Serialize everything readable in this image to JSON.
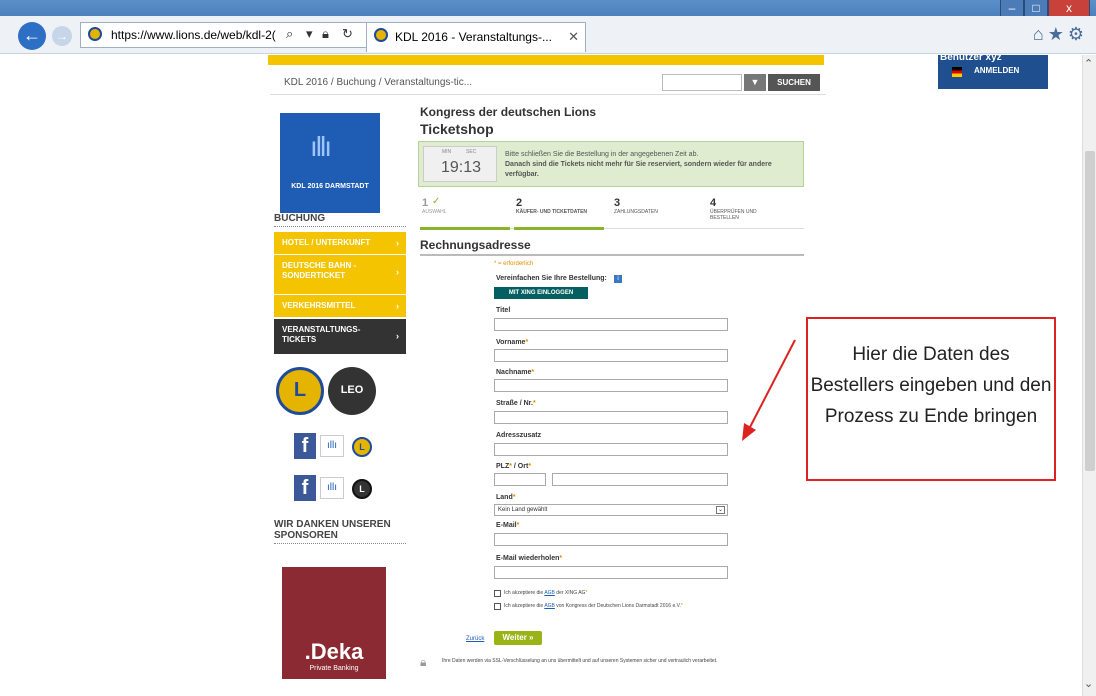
{
  "browser": {
    "url": "https://www.lions.de/web/kdl-2(",
    "tab_title": "KDL 2016 - Veranstaltungs-...",
    "window_controls": [
      "–",
      "□",
      "x"
    ]
  },
  "page": {
    "breadcrumb": "KDL 2016 / Buchung / Veranstaltungs-tic...",
    "search_button": "SUCHEN",
    "user_name": "Benutzer xyz",
    "login": "ANMELDEN",
    "logo_text": "KDL 2016 DARMSTADT",
    "sidebar_heading": "BUCHUNG",
    "sidebar_items": [
      {
        "label": "HOTEL / UNTERKUNFT"
      },
      {
        "label": "DEUTSCHE BAHN - SONDERTICKET"
      },
      {
        "label": "VERKEHRSMITTEL"
      },
      {
        "label": "VERANSTALTUNGS-TICKETS"
      }
    ],
    "sponsors_heading": "WIR DANKEN UNSEREN SPONSOREN",
    "sponsor": {
      "name": ".Deka",
      "tagline": "Private Banking"
    },
    "shop_title": "Kongress der deutschen Lions",
    "shop_subtitle": "Ticketshop",
    "timer": {
      "label_left": "MIN",
      "label_right": "SEC",
      "time": "19:13",
      "message_line1": "Bitte schließen Sie die Bestellung in der angegebenen Zeit ab.",
      "message_line2": "Danach sind die Tickets nicht mehr für Sie reserviert, sondern wieder für andere verfügbar."
    },
    "steps": [
      {
        "num": "1",
        "label": "AUSWAHL"
      },
      {
        "num": "2",
        "label": "KÄUFER- UND TICKETDATEN"
      },
      {
        "num": "3",
        "label": "ZAHLUNGSDATEN"
      },
      {
        "num": "4",
        "label": "ÜBERPRÜFEN UND BESTELLEN"
      }
    ],
    "section_title": "Rechnungsadresse",
    "required_note": "* = erforderlich",
    "xing_note": "Vereinfachen Sie Ihre Bestellung:",
    "xing_button": "MIT XING EINLOGGEN",
    "fields": {
      "titel": "Titel",
      "vorname": "Vorname",
      "nachname": "Nachname",
      "strasse": "Straße / Nr.",
      "adresszusatz": "Adresszusatz",
      "plz_ort_a": "PLZ",
      "plz_ort_b": " / Ort",
      "land": "Land",
      "land_value": "Kein Land gewählt",
      "email": "E-Mail",
      "email_repeat": "E-Mail wiederholen"
    },
    "consent1": {
      "pre": "Ich akzeptiere die ",
      "link": "AGB",
      "post": " der XING AG"
    },
    "consent2": {
      "pre": "Ich akzeptiere die ",
      "link": "AGB",
      "post": " von Kongress der Deutschen Lions Darmstadt 2016 e.V."
    },
    "back_link": "Zurück",
    "next_button": "Weiter »",
    "ssl_note": "Ihre Daten werden via SSL-Verschlüsselung an uns übermittelt und auf unseren Systemen sicher und vertraulich verarbeitet."
  },
  "annotation": {
    "text": "Hier die Daten des Bestellers eingeben und den Prozess zu Ende bringen",
    "color": "#dd2222"
  }
}
